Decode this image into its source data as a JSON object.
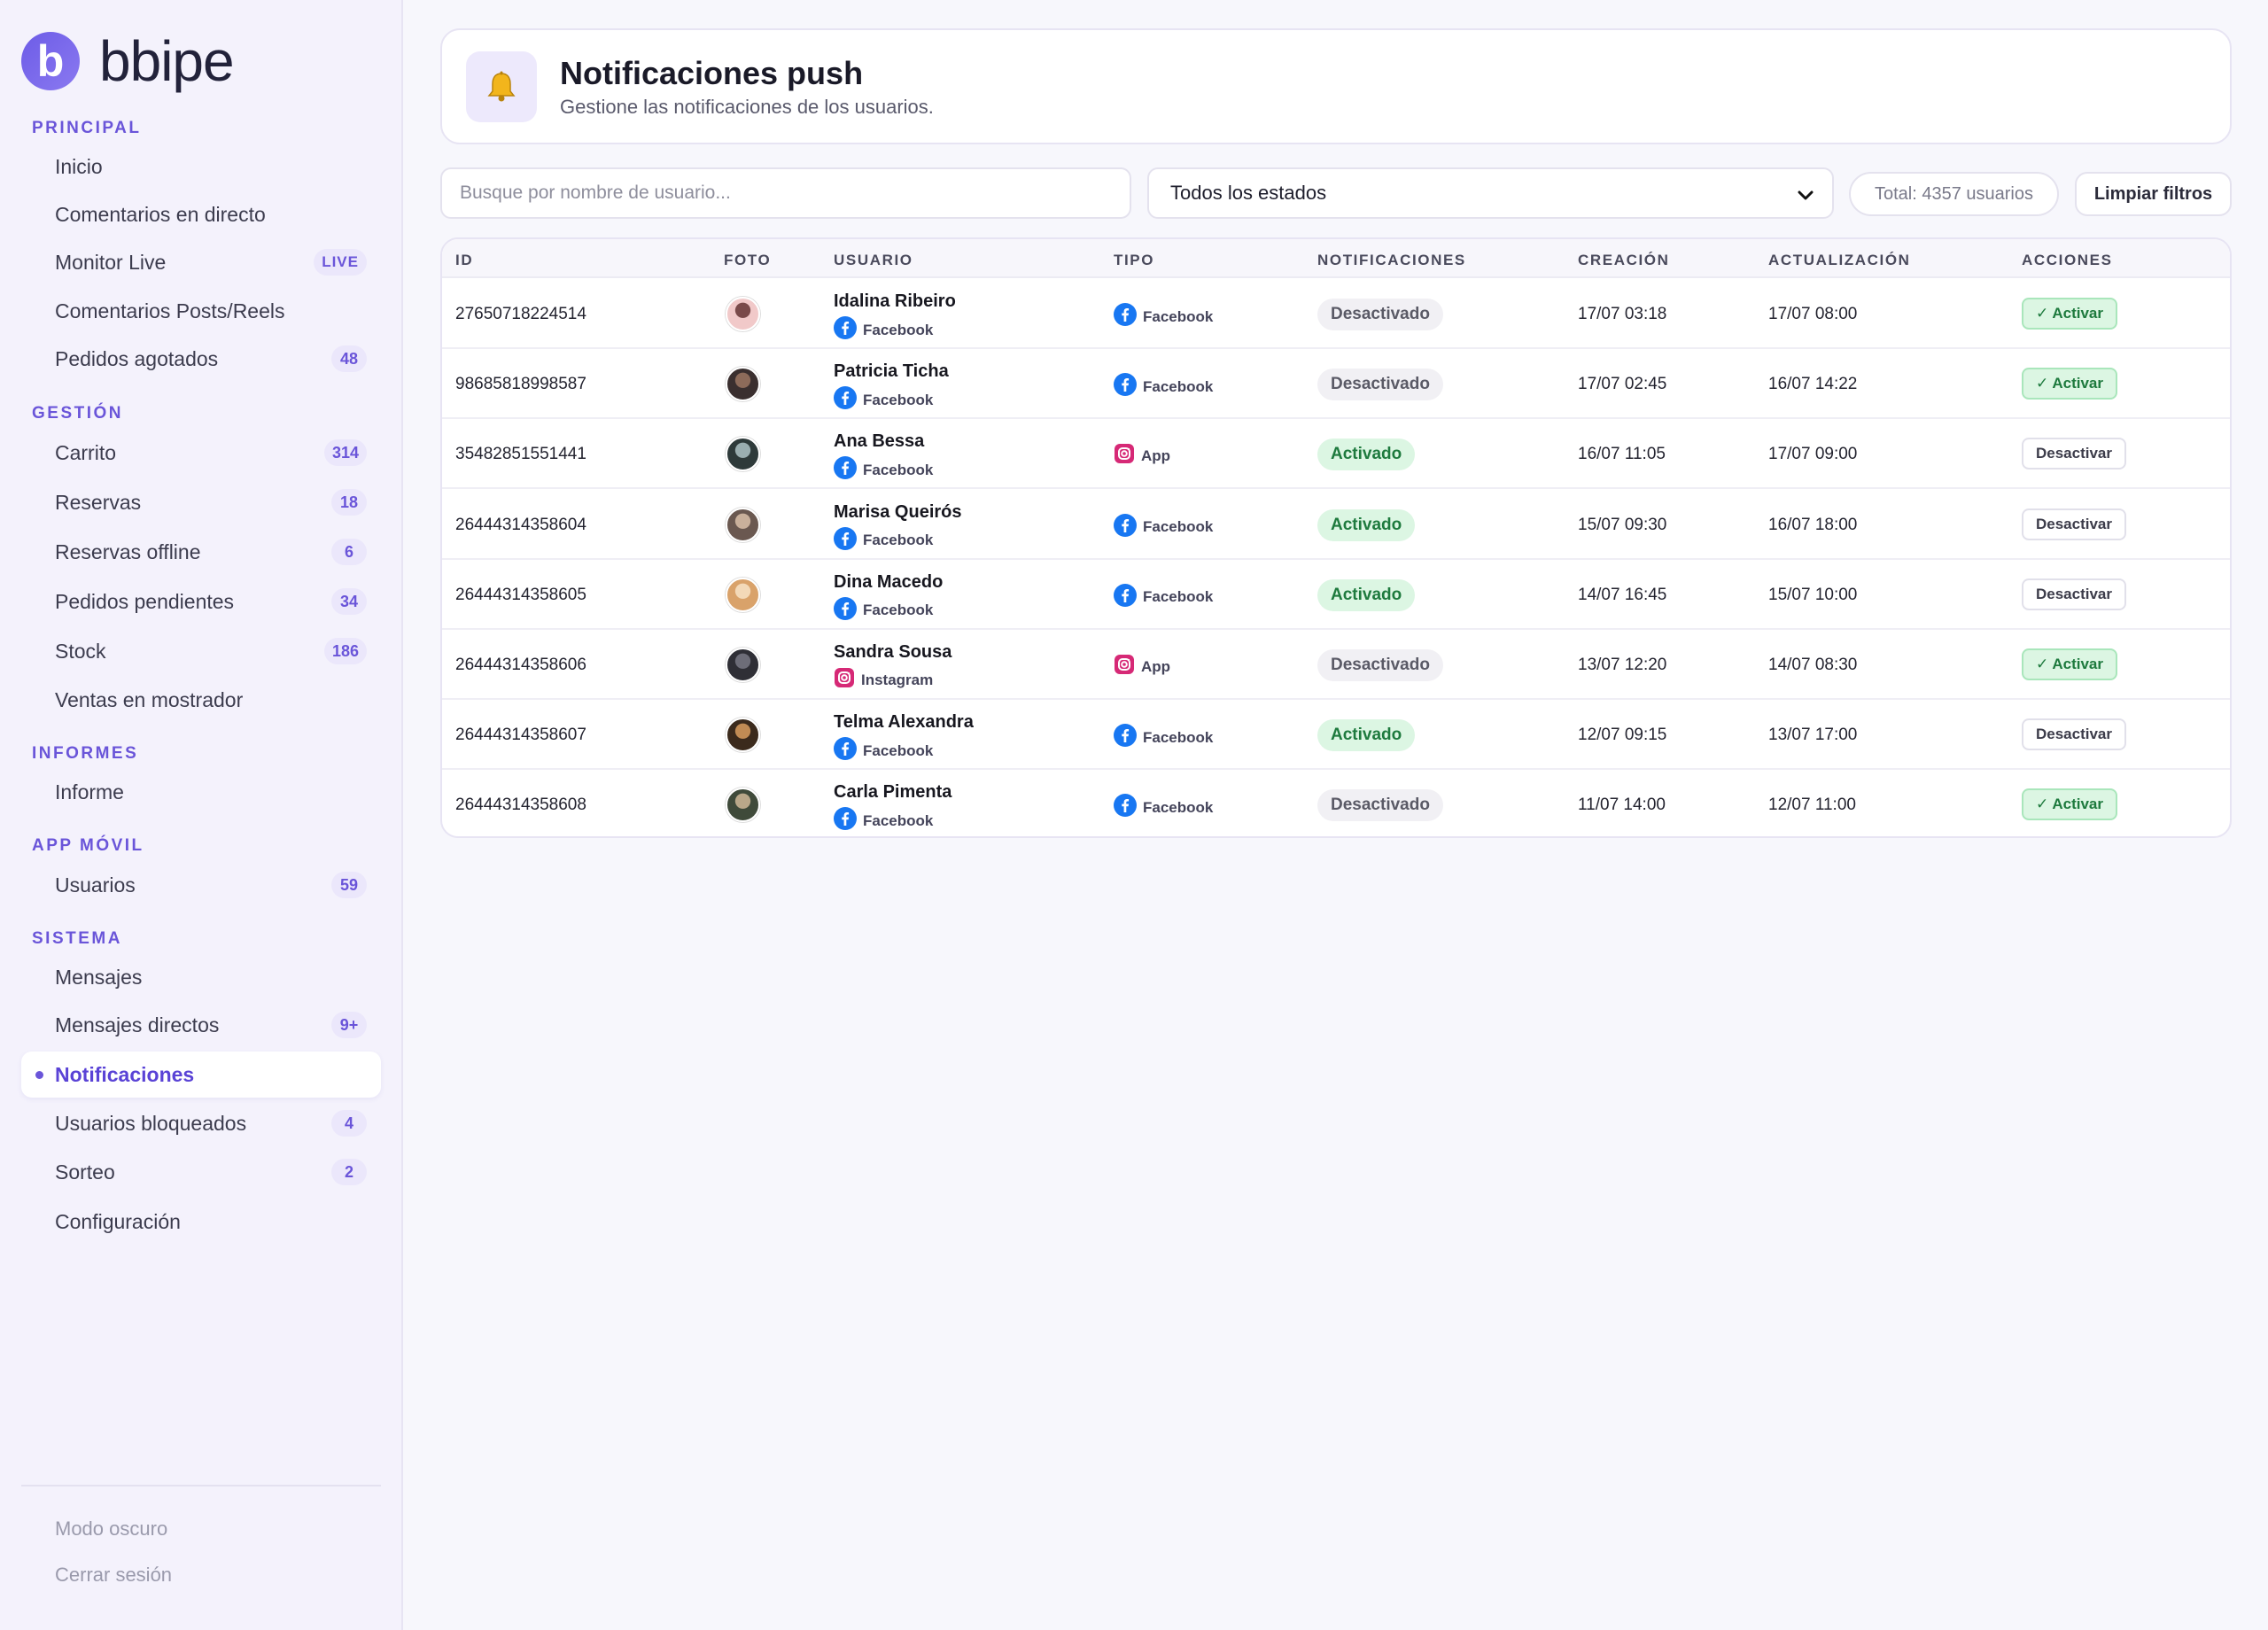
{
  "brand": {
    "logo_letter": "b",
    "name": "bbipe",
    "accent": "#6a55d9"
  },
  "sidebar": {
    "sections": [
      {
        "title": "PRINCIPAL",
        "items": [
          {
            "label": "Inicio",
            "badge": ""
          },
          {
            "label": "Comentarios en directo",
            "badge": ""
          },
          {
            "label": "Monitor Live",
            "badge": "LIVE"
          },
          {
            "label": "Comentarios Posts/Reels",
            "badge": ""
          },
          {
            "label": "Pedidos agotados",
            "badge": "48"
          }
        ]
      },
      {
        "title": "GESTIÓN",
        "items": [
          {
            "label": "Carrito",
            "badge": "314"
          },
          {
            "label": "Reservas",
            "badge": "18"
          },
          {
            "label": "Reservas offline",
            "badge": "6"
          },
          {
            "label": "Pedidos pendientes",
            "badge": "34"
          },
          {
            "label": "Stock",
            "badge": "186"
          },
          {
            "label": "Ventas en mostrador",
            "badge": ""
          }
        ]
      },
      {
        "title": "INFORMES",
        "items": [
          {
            "label": "Informe",
            "badge": ""
          }
        ]
      },
      {
        "title": "APP MÓVIL",
        "items": [
          {
            "label": "Usuarios",
            "badge": "59"
          }
        ]
      },
      {
        "title": "SISTEMA",
        "items": [
          {
            "label": "Mensajes",
            "badge": ""
          },
          {
            "label": "Mensajes directos",
            "badge": "9+"
          },
          {
            "label": "Notificaciones",
            "badge": "",
            "active": true
          },
          {
            "label": "Usuarios bloqueados",
            "badge": "4"
          },
          {
            "label": "Sorteo",
            "badge": "2"
          },
          {
            "label": "Configuración",
            "badge": ""
          }
        ]
      }
    ],
    "footer": {
      "dark_mode": "Modo oscuro",
      "logout": "Cerrar sesión"
    }
  },
  "header": {
    "icon": "bell-icon",
    "title": "Notificaciones push",
    "subtitle": "Gestione las notificaciones de los usuarios."
  },
  "filters": {
    "search_placeholder": "Busque por nombre de usuario...",
    "search_value": "",
    "status_select": "Todos los estados",
    "total": "Total: 4357 usuarios",
    "clear": "Limpiar filtros"
  },
  "table": {
    "columns": [
      "ID",
      "FOTO",
      "USUARIO",
      "TIPO",
      "NOTIFICACIONES",
      "CREACIÓN",
      "ACTUALIZACIÓN",
      "ACCIONES"
    ],
    "rows": [
      {
        "id": "27650718224514",
        "name": "Idalina Ribeiro",
        "source": "Facebook",
        "source_icon": "facebook-icon",
        "type": "Facebook",
        "type_icon": "facebook-icon",
        "status": "Desactivado",
        "created": "17/07 03:18",
        "updated": "17/07 08:00",
        "action": "✓ Activar"
      },
      {
        "id": "98685818998587",
        "name": "Patricia Ticha",
        "source": "Facebook",
        "source_icon": "facebook-icon",
        "type": "Facebook",
        "type_icon": "facebook-icon",
        "status": "Desactivado",
        "created": "17/07 02:45",
        "updated": "16/07 14:22",
        "action": "✓ Activar"
      },
      {
        "id": "35482851551441",
        "name": "Ana Bessa",
        "source": "Facebook",
        "source_icon": "facebook-icon",
        "type": "App",
        "type_icon": "instagram-icon",
        "status": "Activado",
        "created": "16/07 11:05",
        "updated": "17/07 09:00",
        "action": "Desactivar"
      },
      {
        "id": "26444314358604",
        "name": "Marisa Queirós",
        "source": "Facebook",
        "source_icon": "facebook-icon",
        "type": "Facebook",
        "type_icon": "facebook-icon",
        "status": "Activado",
        "created": "15/07 09:30",
        "updated": "16/07 18:00",
        "action": "Desactivar"
      },
      {
        "id": "26444314358605",
        "name": "Dina Macedo",
        "source": "Facebook",
        "source_icon": "facebook-icon",
        "type": "Facebook",
        "type_icon": "facebook-icon",
        "status": "Activado",
        "created": "14/07 16:45",
        "updated": "15/07 10:00",
        "action": "Desactivar"
      },
      {
        "id": "26444314358606",
        "name": "Sandra Sousa",
        "source": "Instagram",
        "source_icon": "instagram-icon",
        "type": "App",
        "type_icon": "instagram-icon",
        "status": "Desactivado",
        "created": "13/07 12:20",
        "updated": "14/07 08:30",
        "action": "✓ Activar"
      },
      {
        "id": "26444314358607",
        "name": "Telma Alexandra",
        "source": "Facebook",
        "source_icon": "facebook-icon",
        "type": "Facebook",
        "type_icon": "facebook-icon",
        "status": "Activado",
        "created": "12/07 09:15",
        "updated": "13/07 17:00",
        "action": "Desactivar"
      },
      {
        "id": "26444314358608",
        "name": "Carla Pimenta",
        "source": "Facebook",
        "source_icon": "facebook-icon",
        "type": "Facebook",
        "type_icon": "facebook-icon",
        "status": "Desactivado",
        "created": "11/07 14:00",
        "updated": "12/07 11:00",
        "action": "✓ Activar"
      }
    ]
  },
  "colors": {
    "facebook": "#1877f2",
    "instagram": "#d62976",
    "active_green": "#1e7a3e",
    "accent": "#6a55d9"
  }
}
